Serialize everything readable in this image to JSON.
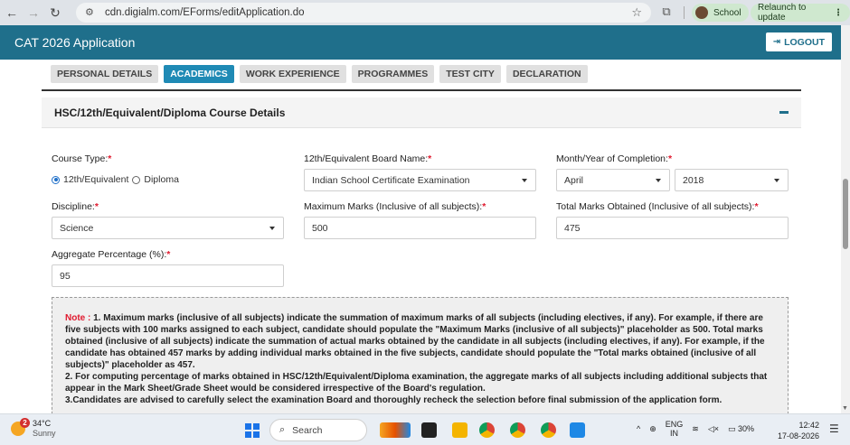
{
  "browser": {
    "url": "cdn.digialm.com/EForms/editApplication.do",
    "profile_label": "School",
    "relaunch_label": "Relaunch to update",
    "menu_glyph": "⋮"
  },
  "app": {
    "title": "CAT 2026 Application",
    "logout_label": "LOGOUT"
  },
  "tabs": [
    {
      "label": "PERSONAL DETAILS",
      "active": false
    },
    {
      "label": "ACADEMICS",
      "active": true
    },
    {
      "label": "WORK EXPERIENCE",
      "active": false
    },
    {
      "label": "PROGRAMMES",
      "active": false
    },
    {
      "label": "TEST CITY",
      "active": false
    },
    {
      "label": "DECLARATION",
      "active": false
    }
  ],
  "section": {
    "title": "HSC/12th/Equivalent/Diploma Course Details"
  },
  "form": {
    "course_type_label": "Course Type:",
    "course_options": [
      "12th/Equivalent",
      "Diploma"
    ],
    "course_selected": "12th/Equivalent",
    "board_label": "12th/Equivalent Board Name:",
    "board_value": "Indian School Certificate Examination",
    "completion_label": "Month/Year of Completion:",
    "month_value": "April",
    "year_value": "2018",
    "discipline_label": "Discipline:",
    "discipline_value": "Science",
    "max_marks_label": "Maximum Marks (Inclusive of all subjects):",
    "max_marks_value": "500",
    "total_marks_label": "Total Marks Obtained (Inclusive of all subjects):",
    "total_marks_value": "475",
    "aggregate_label": "Aggregate Percentage (%):",
    "aggregate_value": "95",
    "required_mark": "*"
  },
  "note": {
    "prefix": "Note :",
    "p1": " 1. Maximum marks (inclusive of all subjects) indicate the summation of maximum marks of all subjects (including electives, if any). For example, if there are five subjects with 100 marks assigned to each subject, candidate should populate the \"Maximum Marks (inclusive of all subjects)\" placeholder as 500. Total marks obtained (inclusive of all subjects) indicate the summation of actual marks obtained by the candidate in all subjects (including electives, if any). For example, if the candidate has obtained 457 marks by adding individual marks obtained in the five subjects, candidate should populate the \"Total marks obtained (inclusive of all subjects)\" placeholder as 457.",
    "p2": "2. For computing percentage of marks obtained in HSC/12th/Equivalent/Diploma examination, the aggregate marks of all subjects including additional subjects that appear in the Mark Sheet/Grade Sheet would be considered irrespective of the Board's regulation.",
    "p3": "3.Candidates are advised to carefully select the examination Board and thoroughly recheck the selection before final submission of the application form."
  },
  "taskbar": {
    "weather_temp": "34°C",
    "weather_cond": "Sunny",
    "weather_badge": "2",
    "search_label": "Search",
    "lang_top": "ENG",
    "lang_bottom": "IN",
    "battery": "30%",
    "time": "12:42",
    "date": "17-08-2026"
  }
}
